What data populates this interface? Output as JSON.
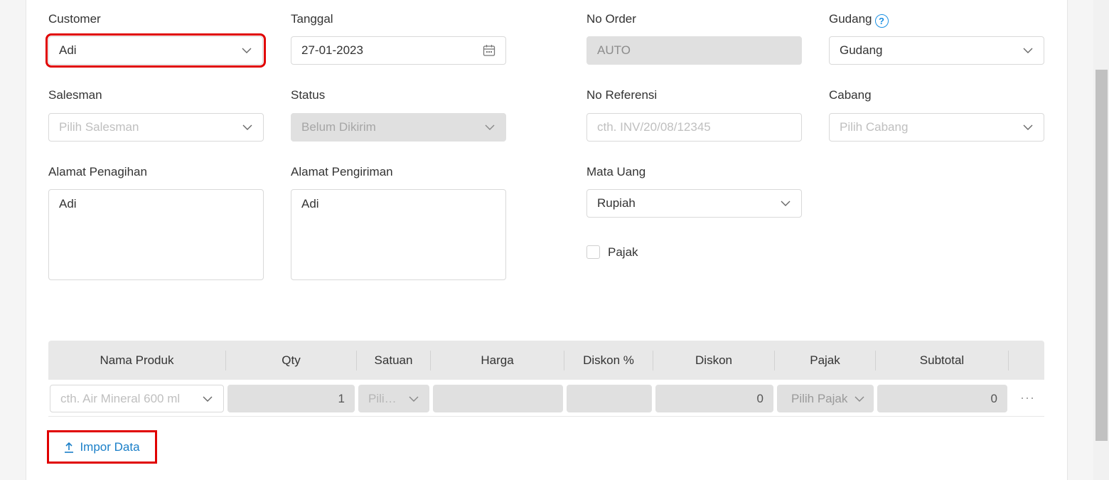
{
  "form": {
    "customer": {
      "label": "Customer",
      "value": "Adi"
    },
    "tanggal": {
      "label": "Tanggal",
      "value": "27-01-2023"
    },
    "no_order": {
      "label": "No Order",
      "value": "AUTO"
    },
    "gudang": {
      "label": "Gudang",
      "value": "Gudang",
      "help": "?"
    },
    "salesman": {
      "label": "Salesman",
      "placeholder": "Pilih Salesman"
    },
    "status": {
      "label": "Status",
      "value": "Belum Dikirim"
    },
    "no_referensi": {
      "label": "No Referensi",
      "placeholder": "cth. INV/20/08/12345"
    },
    "cabang": {
      "label": "Cabang",
      "placeholder": "Pilih Cabang"
    },
    "alamat_penagihan": {
      "label": "Alamat Penagihan",
      "value": "Adi"
    },
    "alamat_pengiriman": {
      "label": "Alamat Pengiriman",
      "value": "Adi"
    },
    "mata_uang": {
      "label": "Mata Uang",
      "value": "Rupiah"
    },
    "pajak": {
      "label": "Pajak",
      "checked": false
    }
  },
  "table": {
    "columns": [
      "Nama Produk",
      "Qty",
      "Satuan",
      "Harga",
      "Diskon %",
      "Diskon",
      "Pajak",
      "Subtotal"
    ],
    "row": {
      "nama_produk_placeholder": "cth. Air Mineral 600 ml",
      "qty": "1",
      "satuan_placeholder": "Pili…",
      "harga": "",
      "diskon_persen": "",
      "diskon": "0",
      "pajak_placeholder": "Pilih Pajak",
      "subtotal": "0",
      "more": "···"
    }
  },
  "actions": {
    "import_label": "Impor Data"
  },
  "colors": {
    "highlight": "#e00000",
    "link": "#1a7fc8",
    "help_icon": "#1a8fe3"
  }
}
